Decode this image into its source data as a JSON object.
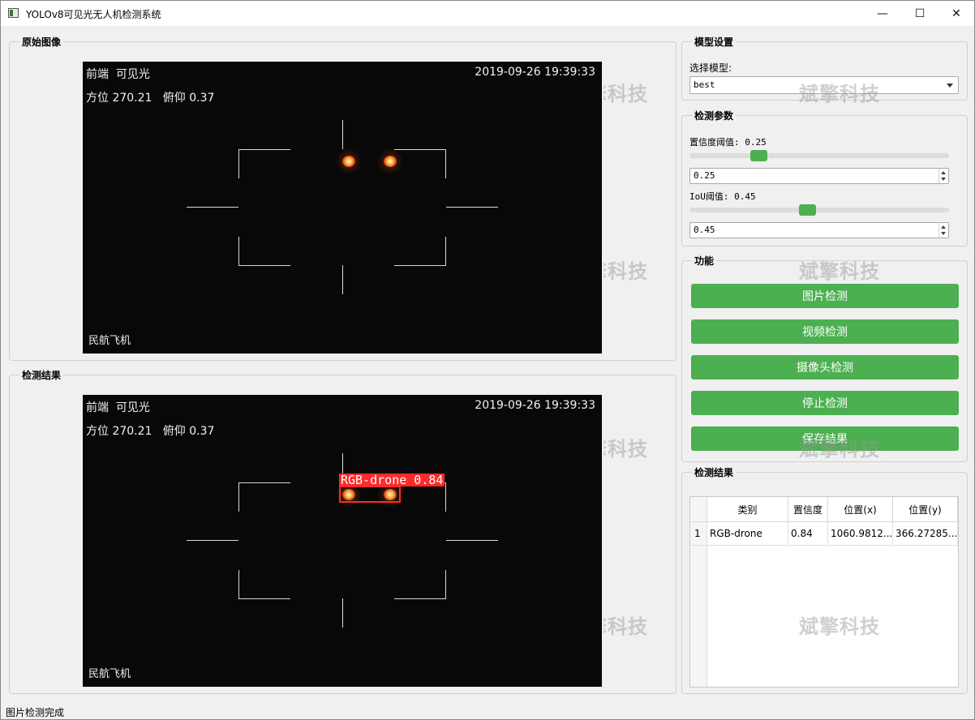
{
  "window": {
    "title": "YOLOv8可见光无人机检测系统",
    "minimize_glyph": "—",
    "maximize_glyph": "☐",
    "close_glyph": "✕"
  },
  "original_panel": {
    "title": "原始图像"
  },
  "result_panel": {
    "title": "检测结果"
  },
  "osd": {
    "mode": "前端  可见光",
    "timestamp": "2019-09-26 19:39:33",
    "orientation": "方位 270.21   俯仰 0.37",
    "target_type": "民航飞机"
  },
  "detection": {
    "label": "RGB-drone  0.84",
    "box_color": "#ff2a2a"
  },
  "watermark": "斌擎科技",
  "model_settings": {
    "title": "模型设置",
    "select_label": "选择模型:",
    "selected_model": "best"
  },
  "detect_params": {
    "title": "检测参数",
    "confidence_label": "置信度阈值: 0.25",
    "confidence_value": "0.25",
    "confidence_fraction": 0.25,
    "iou_label": "IoU阈值: 0.45",
    "iou_value": "0.45",
    "iou_fraction": 0.45,
    "accent_color": "#4caf50"
  },
  "functions": {
    "title": "功能",
    "buttons": [
      "图片检测",
      "视频检测",
      "摄像头检测",
      "停止检测",
      "保存结果"
    ]
  },
  "results_table": {
    "title": "检测结果",
    "headers": [
      "类别",
      "置信度",
      "位置(x)",
      "位置(y)"
    ],
    "rows": [
      {
        "index": "1",
        "class": "RGB-drone",
        "confidence": "0.84",
        "x": "1060.9812...",
        "y": "366.27285..."
      }
    ]
  },
  "status": "图片检测完成"
}
